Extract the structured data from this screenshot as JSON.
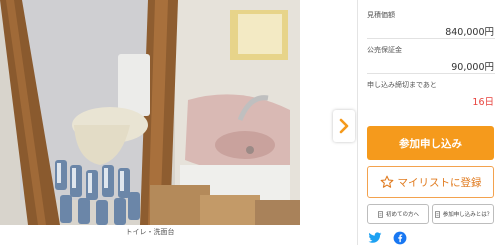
{
  "gallery": {
    "caption": "トイレ・洗面台",
    "next_icon": "chevron-right-icon"
  },
  "panel": {
    "estimate_label": "見積価額",
    "estimate_value": "840,000円",
    "deposit_label": "公売保証金",
    "deposit_value": "90,000円",
    "deadline_label": "申し込み締切まであと",
    "deadline_value": "16日",
    "apply_label": "参加申し込み",
    "mylist_label": "マイリストに登録",
    "first_time_label": "初めての方へ",
    "what_is_label": "参加申し込みとは？",
    "social": [
      "twitter-icon",
      "facebook-icon"
    ]
  },
  "colors": {
    "accent_orange": "#f59a1c",
    "deadline_red": "#e8433e",
    "twitter_blue": "#1da1f2",
    "facebook_blue": "#1877f2"
  }
}
